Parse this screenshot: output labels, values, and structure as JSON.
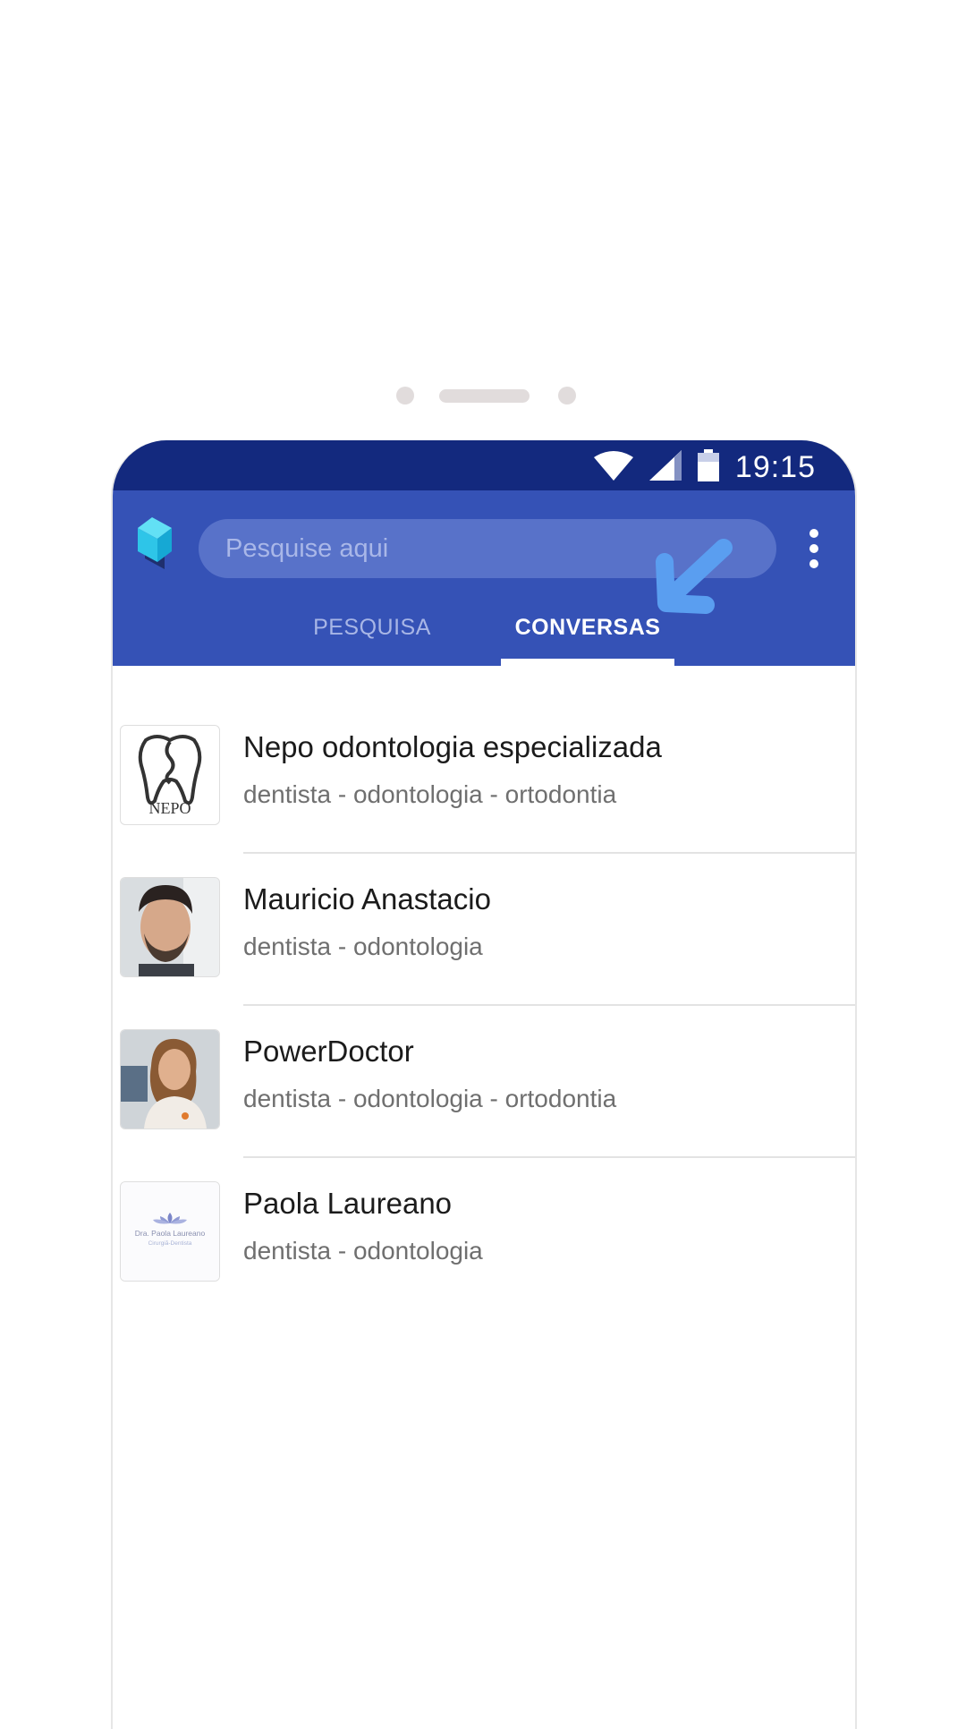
{
  "status_bar": {
    "time": "19:15",
    "icons": [
      "wifi-icon",
      "signal-icon",
      "battery-icon"
    ]
  },
  "app_bar": {
    "logo": "app-logo",
    "search_placeholder": "Pesquise aqui",
    "menu_icon": "more-vert-icon"
  },
  "tabs": [
    {
      "label": "PESQUISA",
      "active": false
    },
    {
      "label": "CONVERSAS",
      "active": true
    }
  ],
  "conversations": [
    {
      "name": "Nepo odontologia especializada",
      "tags": "dentista - odontologia - ortodontia",
      "avatar": "nepo-logo"
    },
    {
      "name": "Mauricio Anastacio",
      "tags": "dentista - odontologia",
      "avatar": "man-photo"
    },
    {
      "name": "PowerDoctor",
      "tags": "dentista - odontologia - ortodontia",
      "avatar": "woman-photo"
    },
    {
      "name": "Paola Laureano",
      "tags": "dentista - odontologia",
      "avatar": "paola-logo"
    }
  ],
  "avatar_text": {
    "nepo": "NEPO",
    "paola_line1": "Dra. Paola Laureano",
    "paola_line2": "Cirurgiã-Dentista"
  },
  "colors": {
    "status_bar": "#13297e",
    "app_bar": "#3552b6",
    "search_bg": "#5872c9",
    "tab_inactive": "#a8b6e6",
    "arrow": "#5a9ef0"
  }
}
